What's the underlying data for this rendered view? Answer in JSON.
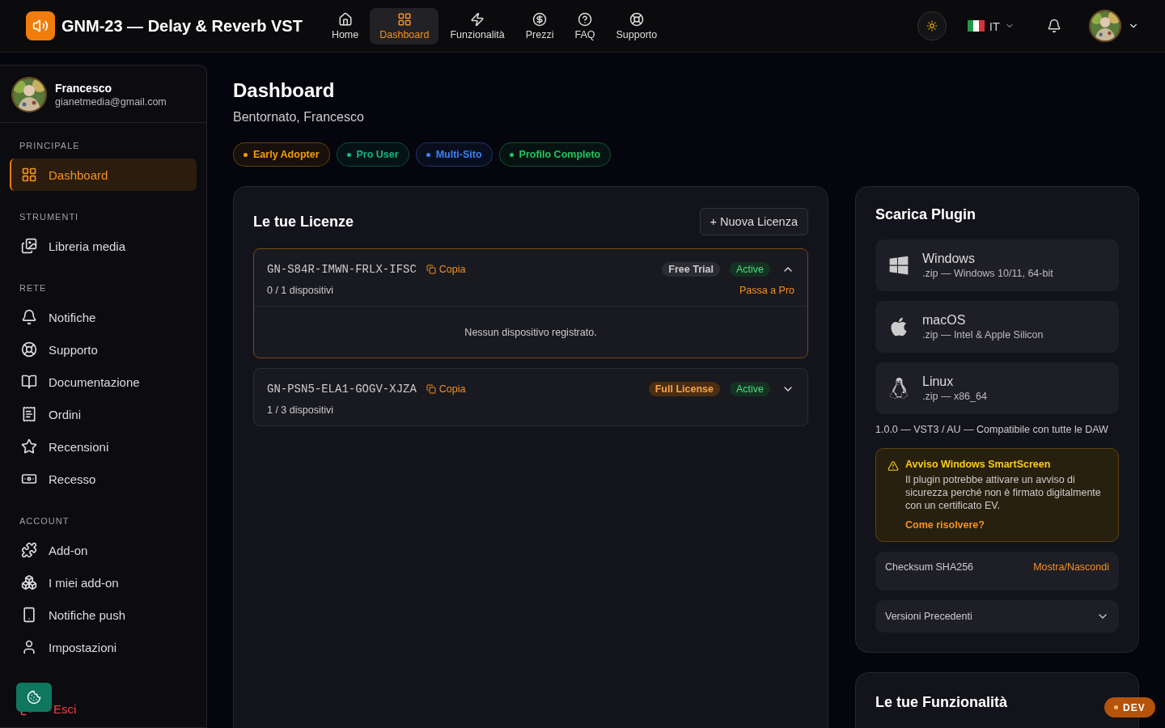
{
  "header": {
    "title": "GNM-23 — Delay & Reverb VST",
    "nav": [
      {
        "label": "Home",
        "selected": false
      },
      {
        "label": "Dashboard",
        "selected": true
      },
      {
        "label": "Funzionalità",
        "selected": false
      },
      {
        "label": "Prezzi",
        "selected": false
      },
      {
        "label": "FAQ",
        "selected": false
      },
      {
        "label": "Supporto",
        "selected": false
      }
    ],
    "language": "IT"
  },
  "sidebar": {
    "user": {
      "name": "Francesco",
      "email": "gianetmedia@gmail.com"
    },
    "sections": [
      {
        "title": "PRINCIPALE",
        "items": [
          {
            "label": "Dashboard",
            "selected": true
          }
        ]
      },
      {
        "title": "STRUMENTI",
        "items": [
          {
            "label": "Libreria media",
            "selected": false
          }
        ]
      },
      {
        "title": "RETE",
        "items": [
          {
            "label": "Notifiche",
            "selected": false
          },
          {
            "label": "Supporto",
            "selected": false
          },
          {
            "label": "Documentazione",
            "selected": false
          },
          {
            "label": "Ordini",
            "selected": false
          },
          {
            "label": "Recensioni",
            "selected": false
          },
          {
            "label": "Recesso",
            "selected": false
          }
        ]
      },
      {
        "title": "ACCOUNT",
        "items": [
          {
            "label": "Add-on",
            "selected": false
          },
          {
            "label": "I miei add-on",
            "selected": false
          },
          {
            "label": "Notifiche push",
            "selected": false
          },
          {
            "label": "Impostazioni",
            "selected": false
          }
        ]
      }
    ],
    "logout": "Esci"
  },
  "page": {
    "title": "Dashboard",
    "subtitle": "Bentornato, Francesco",
    "achievements": [
      {
        "label": "Early Adopter",
        "color": "#f59e0b"
      },
      {
        "label": "Pro User",
        "color": "#10b981"
      },
      {
        "label": "Multi-Sito",
        "color": "#3b82f6"
      },
      {
        "label": "Profilo Completo",
        "color": "#22c55e"
      }
    ]
  },
  "licenses": {
    "title": "Le tue Licenze",
    "new_button": "+ Nuova Licenza",
    "items": [
      {
        "key": "GN-S84R-IMWN-FRLX-IFSC",
        "copy": "Copia",
        "kind": "trial",
        "plan": "Free Trial",
        "status": "Active",
        "devices": "0 / 1 dispositivi",
        "upgrade": "Passa a Pro",
        "expanded": true,
        "empty_message": "Nessun dispositivo registrato."
      },
      {
        "key": "GN-PSN5-ELA1-GOGV-XJZA",
        "copy": "Copia",
        "kind": "full",
        "plan": "Full License",
        "status": "Active",
        "devices": "1 / 3 dispositivi",
        "expanded": false
      }
    ]
  },
  "downloads": {
    "title": "Scarica Plugin",
    "items": [
      {
        "name": "Windows",
        "detail": ".zip — Windows 10/11, 64-bit"
      },
      {
        "name": "macOS",
        "detail": ".zip — Intel & Apple Silicon"
      },
      {
        "name": "Linux",
        "detail": ".zip — x86_64"
      }
    ],
    "version_note": "1.0.0 — VST3 / AU — Compatibile con tutte le DAW",
    "warning": {
      "title": "Avviso Windows SmartScreen",
      "text": "Il plugin potrebbe attivare un avviso di sicurezza perché non è firmato digitalmente con un certificato EV.",
      "link": "Come risolvere?"
    },
    "checksum": {
      "label": "Checksum SHA256",
      "action": "Mostra/Nascondi"
    },
    "previous": {
      "label": "Versioni Precedenti",
      "expanded": false
    }
  },
  "features": {
    "title": "Le tue Funzionalità"
  },
  "dev_badge": "DEV"
}
